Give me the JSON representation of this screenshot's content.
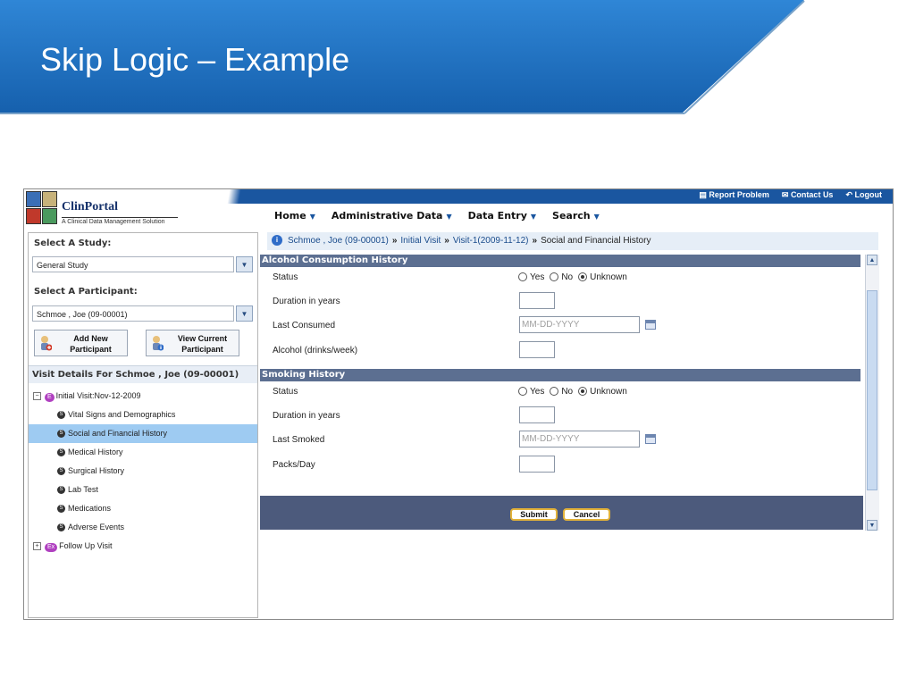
{
  "slide": {
    "title": "Skip Logic – Example"
  },
  "app": {
    "logo": {
      "name": "ClinPortal",
      "subtitle": "A Clinical Data Management Solution"
    },
    "top_links": {
      "report": "Report Problem",
      "contact": "Contact Us",
      "logout": "Logout"
    },
    "main_nav": [
      "Home",
      "Administrative Data",
      "Data Entry",
      "Search"
    ],
    "left": {
      "study_label": "Select A Study:",
      "study_value": "General Study",
      "participant_label": "Select A Participant:",
      "participant_value": "Schmoe , Joe (09-00001)",
      "add_new": [
        "Add New",
        "Participant"
      ],
      "view_current": [
        "View Current",
        "Participant"
      ],
      "visit_details": "Visit Details For  Schmoe , Joe (09-00001)",
      "tree": {
        "initial_visit": "Initial Visit:Nov-12-2009",
        "initial_badge": "E",
        "forms": [
          "Vital Signs and Demographics",
          "Social and Financial History",
          "Medical History",
          "Surgical History",
          "Lab Test",
          "Medications",
          "Adverse Events"
        ],
        "form_badge": "S",
        "selected_index": 1,
        "follow_up": "Follow Up Visit",
        "follow_badge": "Ex"
      }
    },
    "breadcrumb": {
      "participant": "Schmoe , Joe (09-00001)",
      "visit": "Initial Visit",
      "instance": "Visit-1(2009-11-12)",
      "form": "Social and Financial History",
      "sep": "»"
    },
    "sections": [
      {
        "title": "Alcohol Consumption History",
        "status_label": "Status",
        "radio_options": [
          "Yes",
          "No",
          "Unknown"
        ],
        "selected": "Unknown",
        "duration_label": "Duration in years",
        "last_label": "Last Consumed",
        "date_placeholder": "MM-DD-YYYY",
        "extra_label": "Alcohol (drinks/week)"
      },
      {
        "title": "Smoking History",
        "status_label": "Status",
        "radio_options": [
          "Yes",
          "No",
          "Unknown"
        ],
        "selected": "Unknown",
        "duration_label": "Duration in years",
        "last_label": "Last Smoked",
        "date_placeholder": "MM-DD-YYYY",
        "extra_label": "Packs/Day"
      }
    ],
    "buttons": {
      "submit": "Submit",
      "cancel": "Cancel"
    },
    "colors": {
      "banner": "#1f6fbe",
      "nav": "#1a56a0",
      "section": "#5c6f91",
      "footer": "#4c5a7c",
      "selected_row": "#9ecbf2"
    }
  }
}
